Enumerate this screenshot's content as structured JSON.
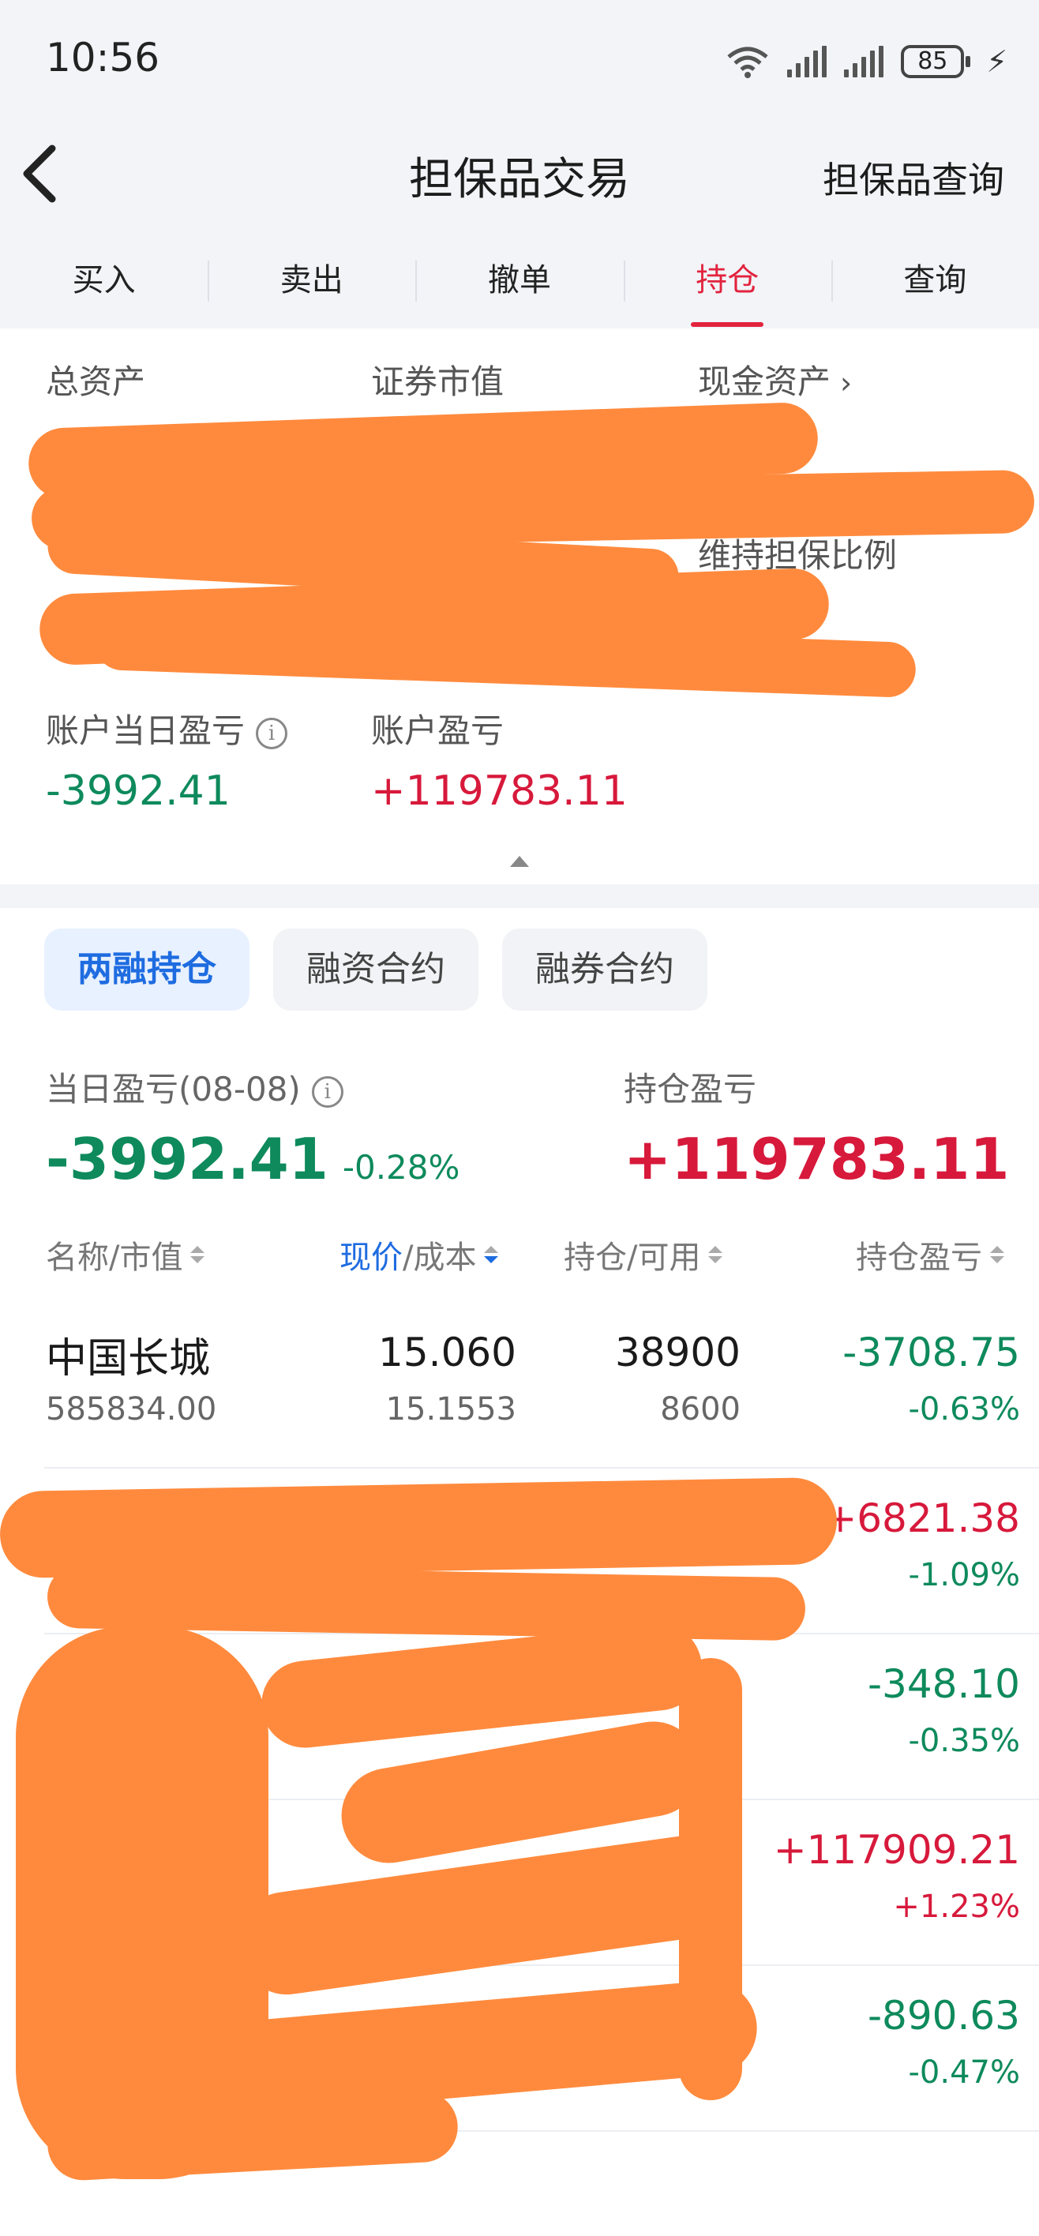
{
  "status_bar": {
    "time": "10:56",
    "battery": "85"
  },
  "nav": {
    "title": "担保品交易",
    "right_link": "担保品查询"
  },
  "tabs": [
    "买入",
    "卖出",
    "撤单",
    "持仓",
    "查询"
  ],
  "summary": {
    "total_assets_label": "总资产",
    "securities_value_label": "证券市值",
    "cash_assets_label": "现金资产",
    "maintenance_ratio_label": "维持担保比例",
    "day_pl_label": "账户当日盈亏",
    "day_pl_value": "-3992.41",
    "account_pl_label": "账户盈亏",
    "account_pl_value": "+119783.11"
  },
  "sub_tabs": [
    "两融持仓",
    "融资合约",
    "融券合约"
  ],
  "pl": {
    "day_label": "当日盈亏(08-08)",
    "day_value": "-3992.41",
    "day_pct": "-0.28%",
    "holding_label": "持仓盈亏",
    "holding_value": "+119783.11"
  },
  "table": {
    "headers": {
      "name": "名称/市值",
      "price_hl": "现价",
      "price_rest": "/成本",
      "qty": "持仓/可用",
      "pl": "持仓盈亏"
    },
    "rows": [
      {
        "name": "中国长城",
        "market_value": "585834.00",
        "price": "15.060",
        "cost": "15.1553",
        "qty": "38900",
        "avail": "8600",
        "pl": "-3708.75",
        "pl_pct": "-0.63%",
        "pl_sign": "neg"
      },
      {
        "name": "",
        "market_value": "",
        "price": "",
        "cost": "",
        "qty": "",
        "avail": "",
        "pl": "+6821.38",
        "pl_pct": "-1.09%",
        "pl_sign": "pos"
      },
      {
        "name": "",
        "market_value": "",
        "price": "",
        "cost": "",
        "qty": "",
        "avail": "",
        "pl": "-348.10",
        "pl_pct": "-0.35%",
        "pl_sign": "neg"
      },
      {
        "name": "",
        "market_value": "",
        "price": "",
        "cost": "",
        "qty": "",
        "avail": "",
        "pl": "+117909.21",
        "pl_pct": "+1.23%",
        "pl_sign": "pos"
      },
      {
        "name": "",
        "market_value": "",
        "price": "",
        "cost": "",
        "qty": "",
        "avail": "",
        "pl": "-890.63",
        "pl_pct": "-0.47%",
        "pl_sign": "neg"
      }
    ]
  },
  "colors": {
    "accent_red": "#d7193b",
    "accent_green": "#0e8a5c",
    "accent_blue": "#1e6ce0",
    "redaction": "#ff8a3d"
  }
}
